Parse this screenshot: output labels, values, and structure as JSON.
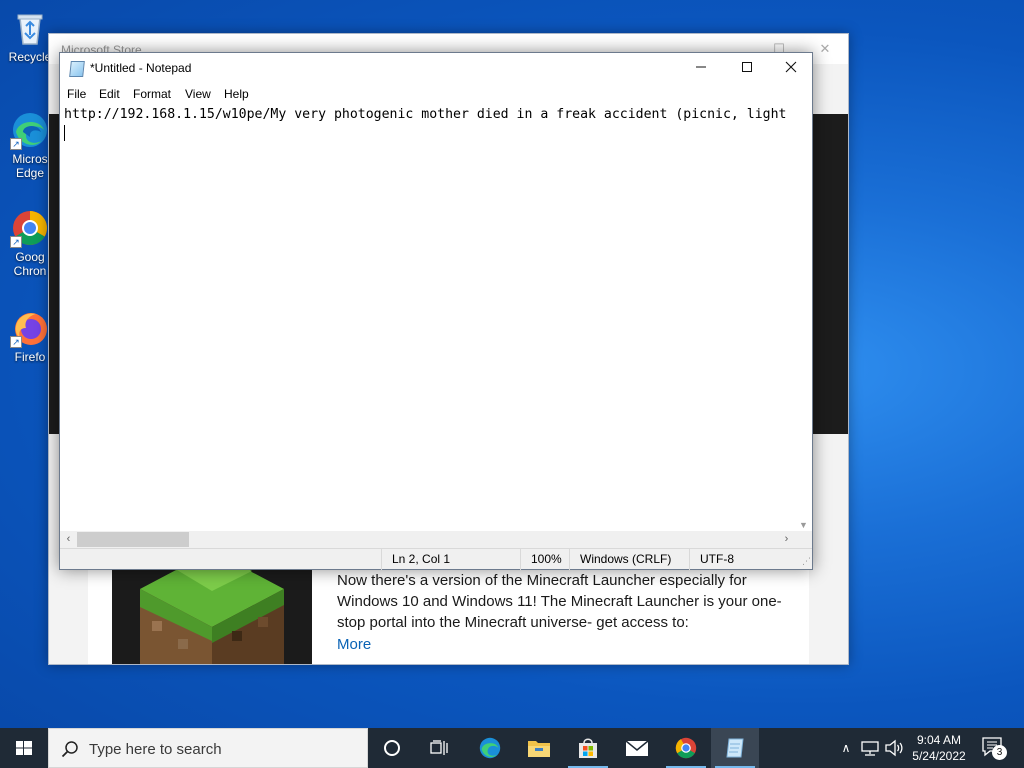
{
  "desktop": {
    "icons": [
      {
        "label": "Recycle",
        "icon": "recycle-bin-icon"
      },
      {
        "label": "Micros\nEdge",
        "icon": "edge-icon"
      },
      {
        "label": "Goog\nChron",
        "icon": "chrome-icon"
      },
      {
        "label": "Firefo",
        "icon": "firefox-icon"
      }
    ]
  },
  "store": {
    "title": "Microsoft Store",
    "description": "Now there's a version of the Minecraft Launcher especially for Windows 10 and Windows 11! The Minecraft Launcher is your one-stop portal into the Minecraft universe- get access to:",
    "more_link": "More"
  },
  "notepad": {
    "title": "*Untitled - Notepad",
    "menu": [
      "File",
      "Edit",
      "Format",
      "View",
      "Help"
    ],
    "content_line1": "http://192.168.1.15/w10pe/My very photogenic mother died in a freak accident (picnic, light",
    "status": {
      "position": "Ln 2, Col 1",
      "zoom": "100%",
      "line_ending": "Windows (CRLF)",
      "encoding": "UTF-8"
    }
  },
  "taskbar": {
    "search_placeholder": "Type here to search",
    "pinned": [
      "task-view-icon",
      "edge-icon",
      "file-explorer-icon",
      "store-icon",
      "mail-icon",
      "chrome-icon",
      "notepad-icon"
    ],
    "clock_time": "9:04 AM",
    "clock_date": "5/24/2022",
    "notification_count": "3"
  },
  "colors": {
    "desktop_blue": "#0b56be",
    "taskbar": "#1f2a36",
    "store_link": "#0a63b5",
    "taskbar_active_underline": "#76b9ed"
  }
}
